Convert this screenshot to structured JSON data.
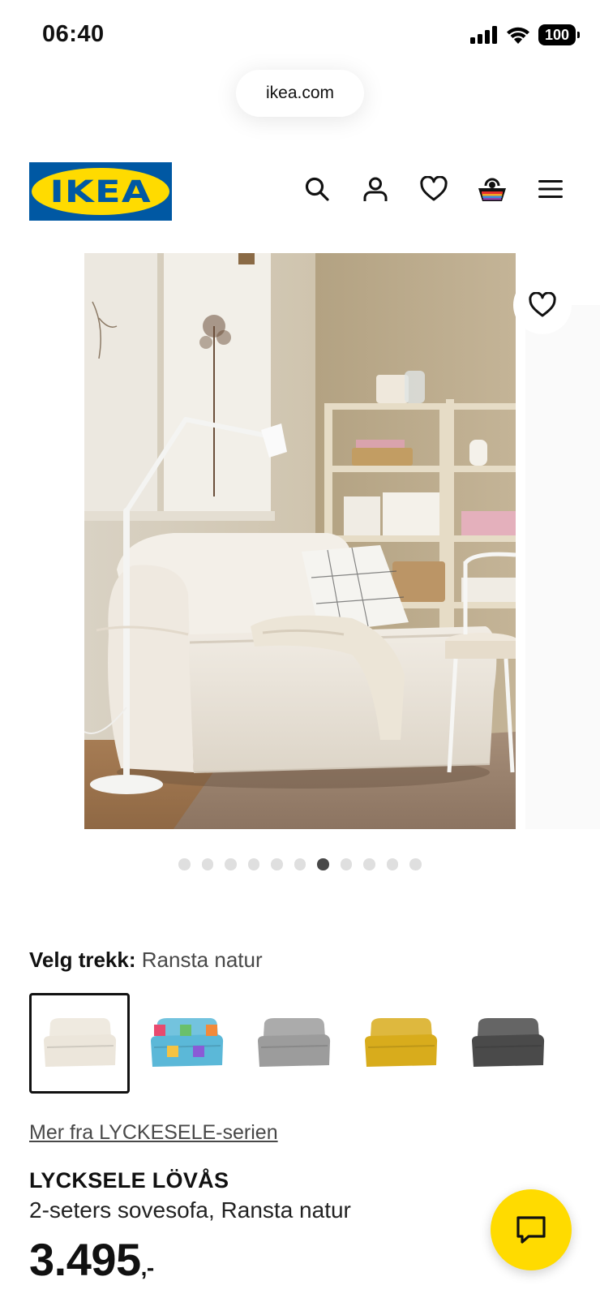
{
  "status_bar": {
    "time": "06:40",
    "battery": "100"
  },
  "browser": {
    "url": "ikea.com"
  },
  "header": {
    "logo_text": "IKEA"
  },
  "gallery": {
    "dot_count": 11,
    "active_index": 6
  },
  "cover": {
    "label": "Velg trekk:",
    "value": "Ransta natur"
  },
  "swatches": [
    {
      "name": "Ransta natur",
      "color": "#ece6db",
      "selected": true
    },
    {
      "name": "multicolor",
      "color": "#5bb8d8",
      "selected": false
    },
    {
      "name": "grey",
      "color": "#9c9c9c",
      "selected": false
    },
    {
      "name": "yellow",
      "color": "#d8ac1c",
      "selected": false
    },
    {
      "name": "dark grey",
      "color": "#4a4a4a",
      "selected": false
    }
  ],
  "product": {
    "series_link": "Mer fra LYCKESELE-serien",
    "name": "LYCKSELE LÖVÅS",
    "description": "2-seters sovesofa, Ransta natur",
    "price": "3.495",
    "price_suffix": ",-"
  },
  "colors": {
    "ikea_blue": "#0058a3",
    "ikea_yellow": "#ffdb00"
  }
}
